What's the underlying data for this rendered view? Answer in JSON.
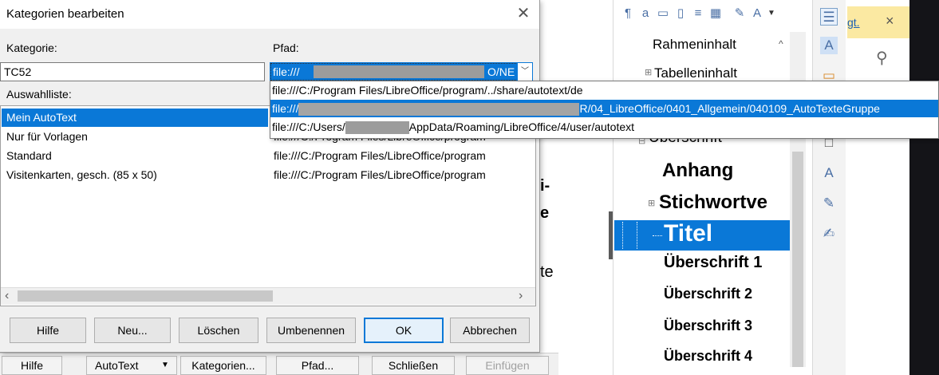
{
  "dialog": {
    "title": "Kategorien bearbeiten",
    "category_label": "Kategorie:",
    "category_value": "TC52",
    "path_label": "Pfad:",
    "path_value_start": "file:///",
    "path_value_end": "O/NE",
    "selection_list_label": "Auswahlliste:",
    "rows": [
      {
        "name": "Mein AutoText",
        "path": ""
      },
      {
        "name": "Nur für Vorlagen",
        "path": "file:///C:/Program Files/LibreOffice/program"
      },
      {
        "name": "Standard",
        "path": "file:///C:/Program Files/LibreOffice/program"
      },
      {
        "name": "Visitenkarten, gesch. (85 x 50)",
        "path": "file:///C:/Program Files/LibreOffice/program"
      }
    ],
    "buttons": {
      "help": "Hilfe",
      "new": "Neu...",
      "delete": "Löschen",
      "rename": "Umbenennen",
      "ok": "OK",
      "cancel": "Abbrechen"
    }
  },
  "path_dropdown": {
    "items": [
      {
        "text": "file:///C:/Program Files/LibreOffice/program/../share/autotext/de"
      },
      {
        "prefix": "file:///",
        "suffix": "R/04_LibreOffice/0401_Allgemein/040109_AutoTexteGruppe"
      },
      {
        "prefix": "file:///C:/Users/",
        "suffix": "AppData/Roaming/LibreOffice/4/user/autotext"
      }
    ]
  },
  "parent_dialog": {
    "buttons": {
      "help": "Hilfe",
      "autotext": "AutoText",
      "categories": "Kategorien...",
      "path": "Pfad...",
      "close": "Schließen",
      "insert": "Einfügen"
    }
  },
  "styles_panel": {
    "items": {
      "frame_contents": "Rahmeninhalt",
      "table_contents": "Tabelleninhalt",
      "heading": "Überschrift",
      "appendix": "Anhang",
      "index_heading": "Stichwortve",
      "title": "Titel",
      "heading1": "Überschrift 1",
      "heading2": "Überschrift 2",
      "heading3": "Überschrift 3",
      "heading4": "Überschrift 4"
    },
    "tab_text": "gt.",
    "close_glyph": "×"
  },
  "document_fragments": {
    "a": "i-",
    "b": "e",
    "c": "te"
  },
  "colors": {
    "selection": "#0a78d7",
    "dialog_bg": "#f0f0f0"
  }
}
